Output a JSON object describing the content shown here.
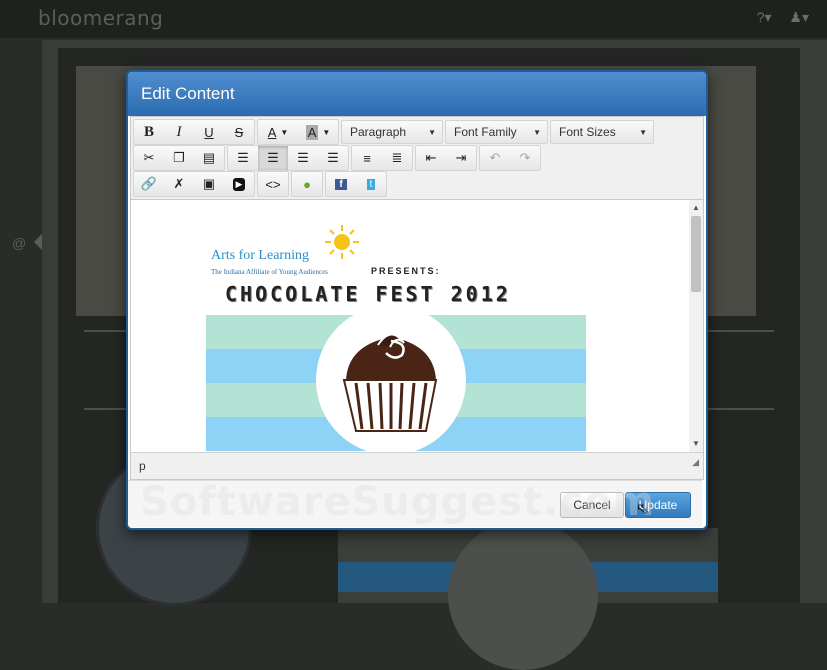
{
  "app": {
    "logo": "bloomerang"
  },
  "modal": {
    "title": "Edit Content",
    "toolbar": {
      "block_format": "Paragraph",
      "font_family": "Font Family",
      "font_sizes": "Font Sizes"
    },
    "status_path": "p",
    "cancel_label": "Cancel",
    "update_label": "Update"
  },
  "flyer": {
    "org_name": "Arts for Learning",
    "org_tagline": "The Indiana Affiliate of Young Audiences",
    "presents": "PRESENTS:",
    "title": "CHOCOLATE FEST 2012"
  },
  "watermark": "SoftwareSuggest.com",
  "colors": {
    "header": "#2b6bb0",
    "accent": "#2f79bd",
    "stripe_teal": "#b3e3d4",
    "stripe_blue": "#8dd3f5"
  }
}
